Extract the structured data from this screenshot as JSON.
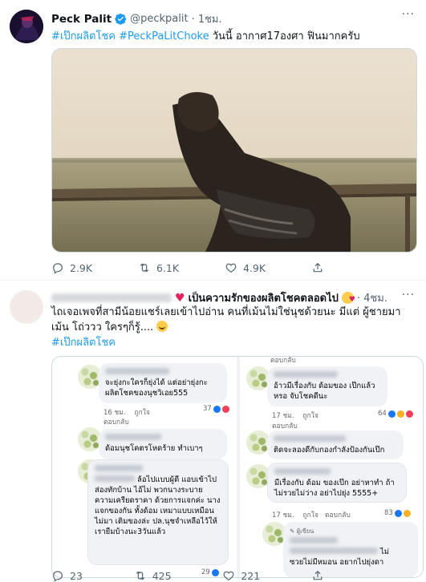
{
  "tweet1": {
    "name": "Peck Palit",
    "handle": "@peckpalit",
    "time": "· 1ชม.",
    "hashtag1": "#เป๊กผลิตโชค",
    "hashtag2": "#PeckPaLitChoke",
    "text": " วันนี้ อากาศ17องศา ฟินมากครับ",
    "replies": "2.9K",
    "retweets": "6.1K",
    "likes": "4.9K"
  },
  "tweet2": {
    "text_head": "เป็นความรักของผลิตโชคตลอดไป",
    "time": "· 4ชม.",
    "body": "ไถเจอเพจที่สามีน้อยแชร์เลยเข้าไปอ่าน คนที่เม้นไม่ใช่นุชด้วยนะ มีแต่ ผู้ชายมาเม้น โถ่ววว ใครๆก็รู้....",
    "hashtag": "#เป๊กผลิตโชค",
    "replies": "23",
    "retweets": "425",
    "likes": "221"
  },
  "fb_left": {
    "c1_text": "จะยุ่งกะใครก็ยุ่งได้ แต่อย่ายุ่งกะ ผลิตโชคของนุชวิเอย555",
    "c1_meta_time": "16 ชม.",
    "c1_meta_like": "ถูกใจ",
    "c1_meta_reply": "ตอบกลับ",
    "c1_count": "37",
    "c2_text": "ด้อมนุชโคตรโหดร้าย  ทำเบาๆ",
    "c3_text": "ล้อไปแบบผู้ดี แอบเข้าไปส่องทักบ้าน ไอ้ไม่ พวกนางระบายความเครียดราคา ด้วยการแจกค่ะ นางแจกของกัน ทั้งด้อม เหมาแบบเหมือนไม่มา เติมของล่ะ ปล.นุชจำเหลือไว้ให้ เรายืมบ้างนะ3วันแล้ว",
    "c3_count": "29"
  },
  "fb_right": {
    "top_reply": "ตอบกลับ",
    "c1_text": "อ้าวมีเรื่องกับ ด้อมของ เป๊กแล้วหรอ จับโชคดีนะ",
    "c1_meta_time": "17 ชม.",
    "c1_meta_like": "ถูกใจ",
    "c1_meta_reply": "ตอบกลับ",
    "c1_count": "64",
    "c2_text": "ติดจะลองดีกับกองกำลังป้องกันเป๊ก",
    "c3_text": "มีเรื่องกับ ด้อม ของเป๊ก อย่าหาทำ ถ้า ไม่รวยไม่ว่าง อย่าไปยุ่ง 5555+",
    "c3_meta_time": "17 ชม.",
    "c3_meta_like": "ถูกใจ",
    "c3_meta_reply": "ตอบกลับ",
    "c3_count": "83",
    "c4_label": "ผู้เขียน",
    "c4_text": "ไม่",
    "c4_text2": "ซวยไม่มีหมอน อยากไปยุ่งดา"
  },
  "colors": {
    "accent": "#1d9bf0",
    "fb_like": "#1877f2",
    "heart": "#e0245e"
  }
}
